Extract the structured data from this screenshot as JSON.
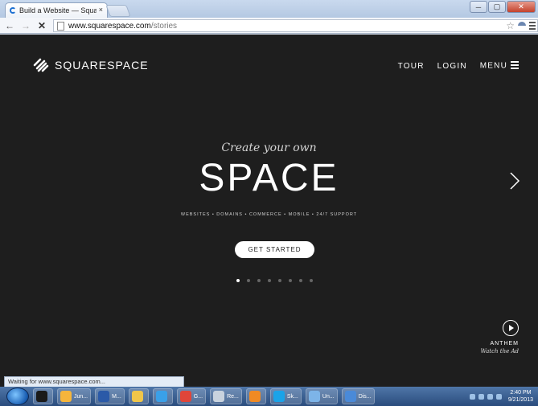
{
  "browser": {
    "tab_title": "Build a Website — Square",
    "tab_close": "×",
    "url_domain": "www.squarespace.com",
    "url_path": "/stories",
    "status_text": "Waiting for www.squarespace.com...",
    "window_buttons": [
      "─",
      "▢",
      "✕"
    ]
  },
  "site": {
    "logo_text": "SQUARESPACE",
    "nav": {
      "tour": "TOUR",
      "login": "LOGIN",
      "menu": "MENU"
    },
    "hero": {
      "tagline": "Create your own",
      "headline": "SPACE",
      "services": "WEBSITES • DOMAINS • COMMERCE • MOBILE • 24/7 SUPPORT",
      "cta": "GET STARTED",
      "slide_count": 8,
      "active_slide": 1
    },
    "anthem": {
      "title": "ANTHEM",
      "subtitle": "Watch the Ad"
    }
  },
  "taskbar": {
    "items": [
      {
        "label": "",
        "color": "#1a1a1a"
      },
      {
        "label": "Jun...",
        "color": "#f5b53c"
      },
      {
        "label": "M...",
        "color": "#2b5aa8"
      },
      {
        "label": "",
        "color": "#f0c64a"
      },
      {
        "label": "",
        "color": "#3aa0e8"
      },
      {
        "label": "G...",
        "color": "#e0463a"
      },
      {
        "label": "Re...",
        "color": "#c9d3de"
      },
      {
        "label": "",
        "color": "#f08a24"
      },
      {
        "label": "Sk...",
        "color": "#1aa3e8"
      },
      {
        "label": "Un...",
        "color": "#7db4e8"
      },
      {
        "label": "Dis...",
        "color": "#4a8ad8"
      }
    ],
    "clock_time": "2:40 PM",
    "clock_date": "9/21/2013"
  }
}
